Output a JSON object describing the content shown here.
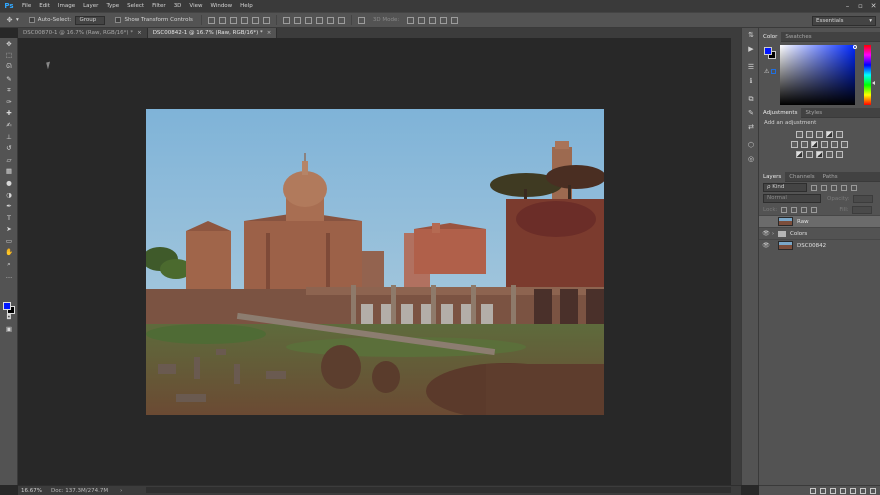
{
  "app": {
    "logo": "Ps"
  },
  "menu": [
    "File",
    "Edit",
    "Image",
    "Layer",
    "Type",
    "Select",
    "Filter",
    "3D",
    "View",
    "Window",
    "Help"
  ],
  "window_controls": [
    "–",
    "▫",
    "✕"
  ],
  "options": {
    "move_icon": "✥",
    "auto_select_label": "Auto-Select:",
    "auto_select_value": "Group",
    "transform_label": "Show Transform Controls",
    "mode_3d_label": "3D Mode:",
    "workspace": "Essentials"
  },
  "tabs": [
    {
      "label": "DSC00870-1 @ 16.7% (Raw, RGB/16*) *",
      "close": "×",
      "active": false
    },
    {
      "label": "DSC00842-1 @ 16.7% (Raw, RGB/16*) *",
      "close": "×",
      "active": true
    }
  ],
  "tools": [
    {
      "name": "move-tool-icon",
      "glyph": "✥"
    },
    {
      "name": "marquee-tool-icon",
      "glyph": "⬚"
    },
    {
      "name": "lasso-tool-icon",
      "glyph": "ᘏ"
    },
    {
      "name": "quick-select-tool-icon",
      "glyph": "✎"
    },
    {
      "name": "crop-tool-icon",
      "glyph": "⌗"
    },
    {
      "name": "eyedropper-tool-icon",
      "glyph": "✑"
    },
    {
      "name": "healing-brush-tool-icon",
      "glyph": "✚"
    },
    {
      "name": "brush-tool-icon",
      "glyph": "✍"
    },
    {
      "name": "clone-stamp-tool-icon",
      "glyph": "⊥"
    },
    {
      "name": "history-brush-tool-icon",
      "glyph": "↺"
    },
    {
      "name": "eraser-tool-icon",
      "glyph": "▱"
    },
    {
      "name": "gradient-tool-icon",
      "glyph": "▦"
    },
    {
      "name": "blur-tool-icon",
      "glyph": "●"
    },
    {
      "name": "dodge-tool-icon",
      "glyph": "◑"
    },
    {
      "name": "pen-tool-icon",
      "glyph": "✒"
    },
    {
      "name": "type-tool-icon",
      "glyph": "T"
    },
    {
      "name": "path-select-tool-icon",
      "glyph": "➤"
    },
    {
      "name": "shape-tool-icon",
      "glyph": "▭"
    },
    {
      "name": "hand-tool-icon",
      "glyph": "✋"
    },
    {
      "name": "zoom-tool-icon",
      "glyph": "⌕"
    },
    {
      "name": "more-tools-icon",
      "glyph": "…"
    }
  ],
  "extra_tools": [
    {
      "name": "quick-mask-icon",
      "glyph": "◘"
    },
    {
      "name": "screen-mode-icon",
      "glyph": "▣"
    }
  ],
  "colors": {
    "foreground": "#0016ff",
    "background": "#000000",
    "accent": "#31a8ff"
  },
  "strip_icons": [
    {
      "name": "history-icon",
      "glyph": "⇅"
    },
    {
      "name": "actions-play-icon",
      "glyph": "▶"
    },
    {
      "name": "properties-icon",
      "glyph": "☰"
    },
    {
      "name": "info-icon",
      "glyph": "ℹ"
    },
    {
      "name": "clone-source-icon",
      "glyph": "⧉"
    },
    {
      "name": "brush-settings-icon",
      "glyph": "✎"
    },
    {
      "name": "tool-presets-icon",
      "glyph": "⇄"
    },
    {
      "name": "3d-icon",
      "glyph": "⬡"
    },
    {
      "name": "paths-icon",
      "glyph": "◎"
    }
  ],
  "color_panel": {
    "tabs": [
      "Color",
      "Swatches"
    ],
    "warning_glyph": "⚠"
  },
  "adjustments_panel": {
    "tabs": [
      "Adjustments",
      "Styles"
    ],
    "hint": "Add an adjustment"
  },
  "layers_panel": {
    "tabs": [
      "Layers",
      "Channels",
      "Paths"
    ],
    "filter_label": "ρ Kind",
    "blend_mode": "Normal",
    "opacity_label": "Opacity:",
    "lock_label": "Lock:",
    "fill_label": "Fill:",
    "layers": [
      {
        "name": "Raw",
        "type": "image",
        "selected": true,
        "visible": false
      },
      {
        "name": "Colors",
        "type": "group",
        "selected": false,
        "visible": true
      },
      {
        "name": "DSC00842",
        "type": "image",
        "selected": false,
        "visible": true
      }
    ]
  },
  "status": {
    "zoom": "16.67%",
    "doc": "Doc: 137.3M/274.7M",
    "arrow": "›"
  }
}
